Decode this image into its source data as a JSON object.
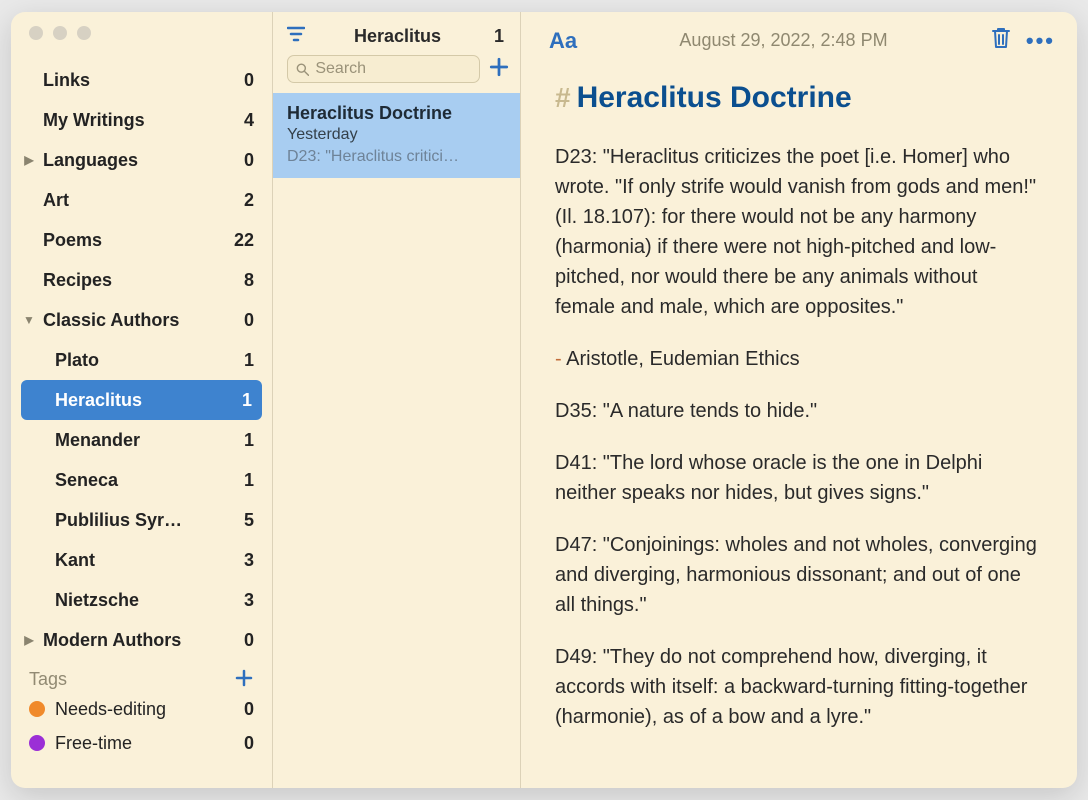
{
  "sidebar": {
    "items": [
      {
        "label": "Links",
        "count": 0,
        "kind": "folder"
      },
      {
        "label": "My Writings",
        "count": 4,
        "kind": "folder"
      },
      {
        "label": "Languages",
        "count": 0,
        "kind": "folder",
        "disclosure": "closed"
      },
      {
        "label": "Art",
        "count": 2,
        "kind": "folder"
      },
      {
        "label": "Poems",
        "count": 22,
        "kind": "folder"
      },
      {
        "label": "Recipes",
        "count": 8,
        "kind": "folder"
      },
      {
        "label": "Classic Authors",
        "count": 0,
        "kind": "folder",
        "disclosure": "open"
      },
      {
        "label": "Plato",
        "count": 1,
        "kind": "child"
      },
      {
        "label": "Heraclitus",
        "count": 1,
        "kind": "child",
        "selected": true
      },
      {
        "label": "Menander",
        "count": 1,
        "kind": "child"
      },
      {
        "label": "Seneca",
        "count": 1,
        "kind": "child"
      },
      {
        "label": "Publilius Syr…",
        "count": 5,
        "kind": "child"
      },
      {
        "label": "Kant",
        "count": 3,
        "kind": "child"
      },
      {
        "label": "Nietzsche",
        "count": 3,
        "kind": "child"
      },
      {
        "label": "Modern Authors",
        "count": 0,
        "kind": "folder",
        "disclosure": "closed"
      }
    ],
    "tags_header": "Tags",
    "tags": [
      {
        "label": "Needs-editing",
        "count": 0,
        "color": "#f08a2b"
      },
      {
        "label": "Free-time",
        "count": 0,
        "color": "#9b2fd6"
      }
    ]
  },
  "list": {
    "title": "Heraclitus",
    "count": 1,
    "search_placeholder": "Search",
    "notes": [
      {
        "title": "Heraclitus Doctrine",
        "date": "Yesterday",
        "preview": "D23: \"Heraclitus critici…"
      }
    ]
  },
  "editor": {
    "aa": "Aa",
    "date": "August 29, 2022, 2:48 PM",
    "more": "•••",
    "hash": "#",
    "title": "Heraclitus Doctrine",
    "paragraphs": [
      "D23: \"Heraclitus criticizes the poet [i.e. Homer] who wrote. \"If only strife would vanish from gods and men!\" (Il. 18.107): for there would not be any harmony (harmonia) if there were not high-pitched and low-pitched, nor would there be any animals without female and male, which are opposites.\"",
      "- Aristotle, Eudemian Ethics",
      "D35: \"A nature tends to hide.\"",
      "D41: \"The lord whose oracle is the one in Delphi neither speaks nor hides, but gives signs.\"",
      "D47: \"Conjoinings: wholes and not wholes, converging and diverging, harmonious dissonant; and out of one all things.\"",
      "D49: \"They do not comprehend how, diverging, it accords with itself: a backward-turning fitting-together (harmonie), as of a bow and a lyre.\""
    ]
  }
}
